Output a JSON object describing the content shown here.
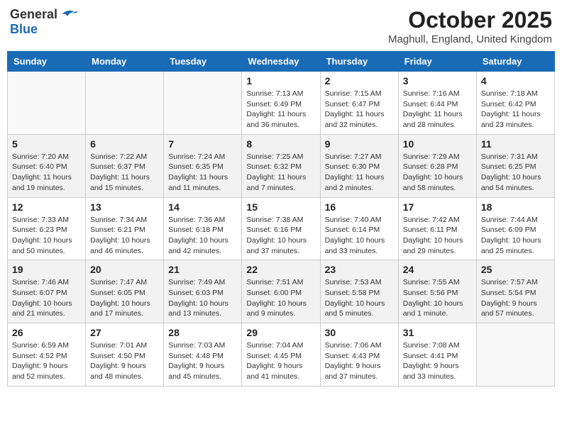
{
  "logo": {
    "general": "General",
    "blue": "Blue"
  },
  "title": "October 2025",
  "location": "Maghull, England, United Kingdom",
  "days_of_week": [
    "Sunday",
    "Monday",
    "Tuesday",
    "Wednesday",
    "Thursday",
    "Friday",
    "Saturday"
  ],
  "weeks": [
    [
      {
        "day": "",
        "sunrise": "",
        "sunset": "",
        "daylight": ""
      },
      {
        "day": "",
        "sunrise": "",
        "sunset": "",
        "daylight": ""
      },
      {
        "day": "",
        "sunrise": "",
        "sunset": "",
        "daylight": ""
      },
      {
        "day": "1",
        "sunrise": "Sunrise: 7:13 AM",
        "sunset": "Sunset: 6:49 PM",
        "daylight": "Daylight: 11 hours and 36 minutes."
      },
      {
        "day": "2",
        "sunrise": "Sunrise: 7:15 AM",
        "sunset": "Sunset: 6:47 PM",
        "daylight": "Daylight: 11 hours and 32 minutes."
      },
      {
        "day": "3",
        "sunrise": "Sunrise: 7:16 AM",
        "sunset": "Sunset: 6:44 PM",
        "daylight": "Daylight: 11 hours and 28 minutes."
      },
      {
        "day": "4",
        "sunrise": "Sunrise: 7:18 AM",
        "sunset": "Sunset: 6:42 PM",
        "daylight": "Daylight: 11 hours and 23 minutes."
      }
    ],
    [
      {
        "day": "5",
        "sunrise": "Sunrise: 7:20 AM",
        "sunset": "Sunset: 6:40 PM",
        "daylight": "Daylight: 11 hours and 19 minutes."
      },
      {
        "day": "6",
        "sunrise": "Sunrise: 7:22 AM",
        "sunset": "Sunset: 6:37 PM",
        "daylight": "Daylight: 11 hours and 15 minutes."
      },
      {
        "day": "7",
        "sunrise": "Sunrise: 7:24 AM",
        "sunset": "Sunset: 6:35 PM",
        "daylight": "Daylight: 11 hours and 11 minutes."
      },
      {
        "day": "8",
        "sunrise": "Sunrise: 7:25 AM",
        "sunset": "Sunset: 6:32 PM",
        "daylight": "Daylight: 11 hours and 7 minutes."
      },
      {
        "day": "9",
        "sunrise": "Sunrise: 7:27 AM",
        "sunset": "Sunset: 6:30 PM",
        "daylight": "Daylight: 11 hours and 2 minutes."
      },
      {
        "day": "10",
        "sunrise": "Sunrise: 7:29 AM",
        "sunset": "Sunset: 6:28 PM",
        "daylight": "Daylight: 10 hours and 58 minutes."
      },
      {
        "day": "11",
        "sunrise": "Sunrise: 7:31 AM",
        "sunset": "Sunset: 6:25 PM",
        "daylight": "Daylight: 10 hours and 54 minutes."
      }
    ],
    [
      {
        "day": "12",
        "sunrise": "Sunrise: 7:33 AM",
        "sunset": "Sunset: 6:23 PM",
        "daylight": "Daylight: 10 hours and 50 minutes."
      },
      {
        "day": "13",
        "sunrise": "Sunrise: 7:34 AM",
        "sunset": "Sunset: 6:21 PM",
        "daylight": "Daylight: 10 hours and 46 minutes."
      },
      {
        "day": "14",
        "sunrise": "Sunrise: 7:36 AM",
        "sunset": "Sunset: 6:18 PM",
        "daylight": "Daylight: 10 hours and 42 minutes."
      },
      {
        "day": "15",
        "sunrise": "Sunrise: 7:38 AM",
        "sunset": "Sunset: 6:16 PM",
        "daylight": "Daylight: 10 hours and 37 minutes."
      },
      {
        "day": "16",
        "sunrise": "Sunrise: 7:40 AM",
        "sunset": "Sunset: 6:14 PM",
        "daylight": "Daylight: 10 hours and 33 minutes."
      },
      {
        "day": "17",
        "sunrise": "Sunrise: 7:42 AM",
        "sunset": "Sunset: 6:11 PM",
        "daylight": "Daylight: 10 hours and 29 minutes."
      },
      {
        "day": "18",
        "sunrise": "Sunrise: 7:44 AM",
        "sunset": "Sunset: 6:09 PM",
        "daylight": "Daylight: 10 hours and 25 minutes."
      }
    ],
    [
      {
        "day": "19",
        "sunrise": "Sunrise: 7:46 AM",
        "sunset": "Sunset: 6:07 PM",
        "daylight": "Daylight: 10 hours and 21 minutes."
      },
      {
        "day": "20",
        "sunrise": "Sunrise: 7:47 AM",
        "sunset": "Sunset: 6:05 PM",
        "daylight": "Daylight: 10 hours and 17 minutes."
      },
      {
        "day": "21",
        "sunrise": "Sunrise: 7:49 AM",
        "sunset": "Sunset: 6:03 PM",
        "daylight": "Daylight: 10 hours and 13 minutes."
      },
      {
        "day": "22",
        "sunrise": "Sunrise: 7:51 AM",
        "sunset": "Sunset: 6:00 PM",
        "daylight": "Daylight: 10 hours and 9 minutes."
      },
      {
        "day": "23",
        "sunrise": "Sunrise: 7:53 AM",
        "sunset": "Sunset: 5:58 PM",
        "daylight": "Daylight: 10 hours and 5 minutes."
      },
      {
        "day": "24",
        "sunrise": "Sunrise: 7:55 AM",
        "sunset": "Sunset: 5:56 PM",
        "daylight": "Daylight: 10 hours and 1 minute."
      },
      {
        "day": "25",
        "sunrise": "Sunrise: 7:57 AM",
        "sunset": "Sunset: 5:54 PM",
        "daylight": "Daylight: 9 hours and 57 minutes."
      }
    ],
    [
      {
        "day": "26",
        "sunrise": "Sunrise: 6:59 AM",
        "sunset": "Sunset: 4:52 PM",
        "daylight": "Daylight: 9 hours and 52 minutes."
      },
      {
        "day": "27",
        "sunrise": "Sunrise: 7:01 AM",
        "sunset": "Sunset: 4:50 PM",
        "daylight": "Daylight: 9 hours and 48 minutes."
      },
      {
        "day": "28",
        "sunrise": "Sunrise: 7:03 AM",
        "sunset": "Sunset: 4:48 PM",
        "daylight": "Daylight: 9 hours and 45 minutes."
      },
      {
        "day": "29",
        "sunrise": "Sunrise: 7:04 AM",
        "sunset": "Sunset: 4:45 PM",
        "daylight": "Daylight: 9 hours and 41 minutes."
      },
      {
        "day": "30",
        "sunrise": "Sunrise: 7:06 AM",
        "sunset": "Sunset: 4:43 PM",
        "daylight": "Daylight: 9 hours and 37 minutes."
      },
      {
        "day": "31",
        "sunrise": "Sunrise: 7:08 AM",
        "sunset": "Sunset: 4:41 PM",
        "daylight": "Daylight: 9 hours and 33 minutes."
      },
      {
        "day": "",
        "sunrise": "",
        "sunset": "",
        "daylight": ""
      }
    ]
  ]
}
